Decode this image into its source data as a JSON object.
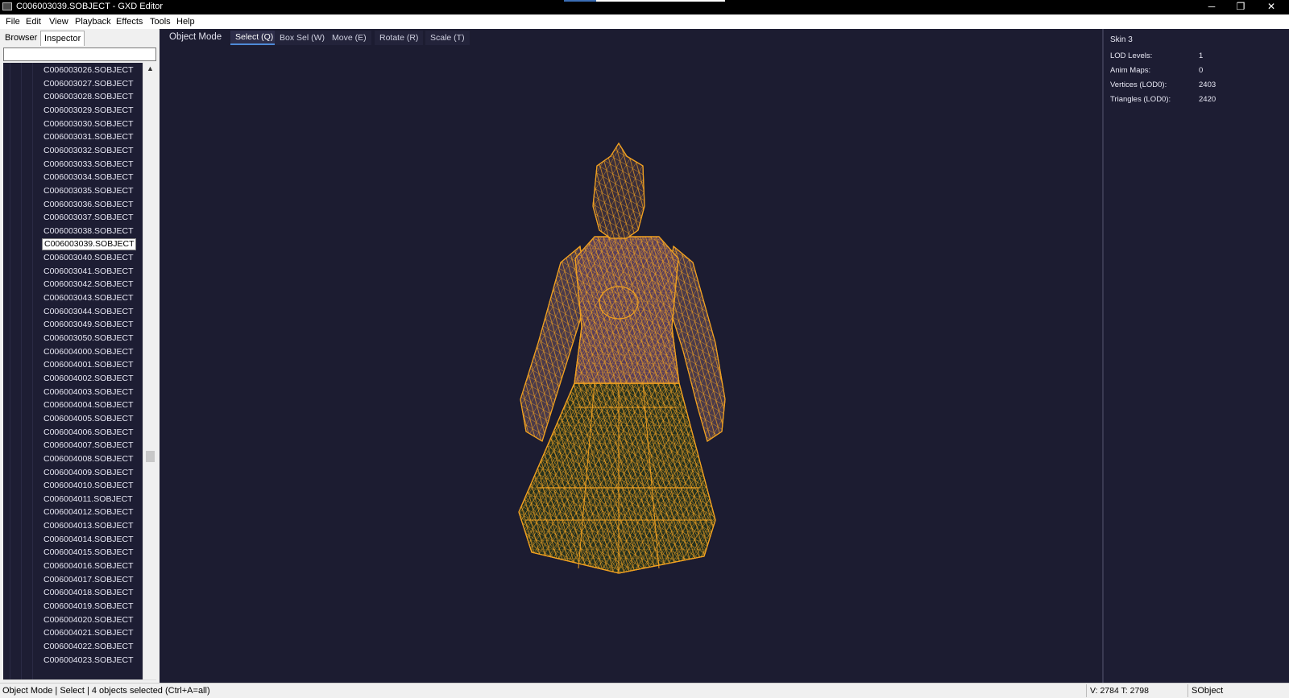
{
  "window": {
    "title": "C006003039.SOBJECT - GXD Editor",
    "minimize_glyph": "─",
    "restore_glyph": "❐",
    "close_glyph": "✕"
  },
  "menu": [
    {
      "label": "File"
    },
    {
      "label": "Edit"
    },
    {
      "label": "View"
    },
    {
      "label": "Playback"
    },
    {
      "label": "Effects"
    },
    {
      "label": "Tools"
    },
    {
      "label": "Help"
    }
  ],
  "left_panel": {
    "tabs": [
      {
        "label": "Browser",
        "active": false
      },
      {
        "label": "Inspector",
        "active": true
      }
    ],
    "filter_value": "",
    "selected_item": "C006003039.SOBJECT",
    "items": [
      "C006003026.SOBJECT",
      "C006003027.SOBJECT",
      "C006003028.SOBJECT",
      "C006003029.SOBJECT",
      "C006003030.SOBJECT",
      "C006003031.SOBJECT",
      "C006003032.SOBJECT",
      "C006003033.SOBJECT",
      "C006003034.SOBJECT",
      "C006003035.SOBJECT",
      "C006003036.SOBJECT",
      "C006003037.SOBJECT",
      "C006003038.SOBJECT",
      "C006003039.SOBJECT",
      "C006003040.SOBJECT",
      "C006003041.SOBJECT",
      "C006003042.SOBJECT",
      "C006003043.SOBJECT",
      "C006003044.SOBJECT",
      "C006003049.SOBJECT",
      "C006003050.SOBJECT",
      "C006004000.SOBJECT",
      "C006004001.SOBJECT",
      "C006004002.SOBJECT",
      "C006004003.SOBJECT",
      "C006004004.SOBJECT",
      "C006004005.SOBJECT",
      "C006004006.SOBJECT",
      "C006004007.SOBJECT",
      "C006004008.SOBJECT",
      "C006004009.SOBJECT",
      "C006004010.SOBJECT",
      "C006004011.SOBJECT",
      "C006004012.SOBJECT",
      "C006004013.SOBJECT",
      "C006004014.SOBJECT",
      "C006004015.SOBJECT",
      "C006004016.SOBJECT",
      "C006004017.SOBJECT",
      "C006004018.SOBJECT",
      "C006004019.SOBJECT",
      "C006004020.SOBJECT",
      "C006004021.SOBJECT",
      "C006004022.SOBJECT",
      "C006004023.SOBJECT"
    ]
  },
  "viewport": {
    "mode_label": "Object Mode",
    "tools": [
      {
        "label": "Select (Q)",
        "active": true
      },
      {
        "label": "Box Sel (W)",
        "active": false
      },
      {
        "label": "Move (E)",
        "active": false
      },
      {
        "label": "Rotate (R)",
        "active": false
      },
      {
        "label": "Scale (T)",
        "active": false
      }
    ],
    "background_color": "#1c1c31",
    "wireframe_color": "#f0a020"
  },
  "properties": {
    "title": "Skin 3",
    "rows": [
      {
        "label": "LOD Levels:",
        "value": "1"
      },
      {
        "label": "Anim Maps:",
        "value": "0"
      },
      {
        "label": "Vertices (LOD0):",
        "value": "2403"
      },
      {
        "label": "Triangles (LOD0):",
        "value": "2420"
      }
    ]
  },
  "status": {
    "left": "Object Mode | Select | 4 objects selected (Ctrl+A=all)",
    "vt": "V: 2784   T: 2798",
    "type": "SObject"
  }
}
